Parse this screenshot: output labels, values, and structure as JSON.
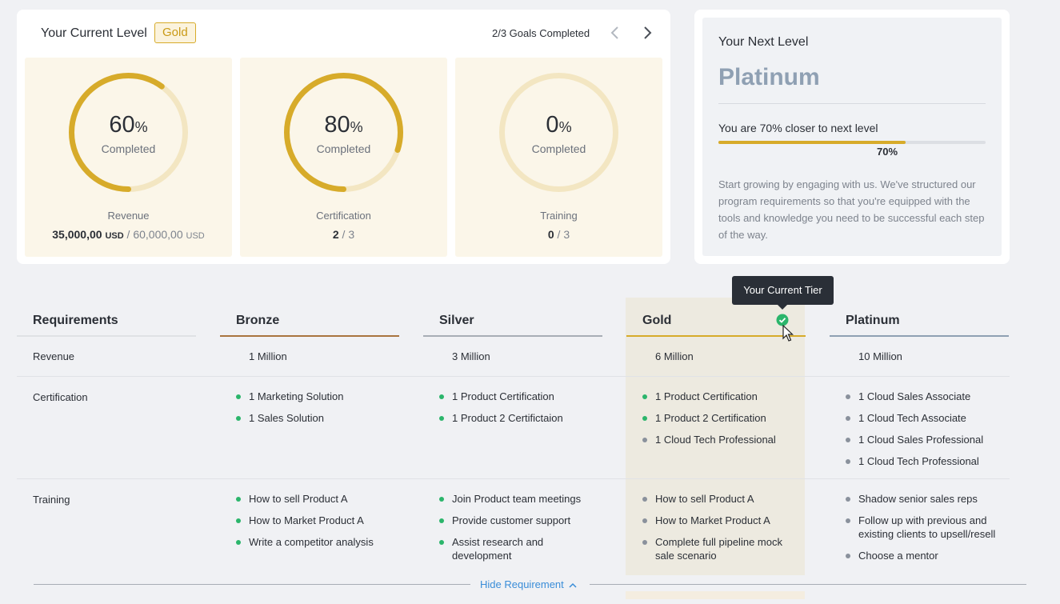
{
  "current_level": {
    "title": "Your Current Level",
    "badge": "Gold",
    "goals": "2/3 Goals Completed",
    "tiles": [
      {
        "percent": "60",
        "percent_value": 60,
        "percent_sign": "%",
        "completed_label": "Completed",
        "name": "Revenue",
        "value_bold": "35,000,00",
        "value_unit": "USD",
        "value_rest": " / 60,000,00 ",
        "value_rest_unit": "USD"
      },
      {
        "percent": "80",
        "percent_value": 80,
        "percent_sign": "%",
        "completed_label": "Completed",
        "name": "Certification",
        "value_bold": "2",
        "value_rest": " / 3"
      },
      {
        "percent": "0",
        "percent_value": 0,
        "percent_sign": "%",
        "completed_label": "Completed",
        "name": "Training",
        "value_bold": "0",
        "value_rest": " / 3"
      }
    ]
  },
  "next_level": {
    "label": "Your Next Level",
    "name": "Platinum",
    "closer_text": "You are 70% closer to next level",
    "progress": 70,
    "progress_label": "70%",
    "description": "Start growing by engaging with us. We've structured our program requirements so that you're equipped with the tools and knowledge you need to be successful each step of the way."
  },
  "tooltip": "Your Current Tier",
  "table": {
    "headers": [
      "Requirements",
      "Bronze",
      "Silver",
      "Gold",
      "Platinum"
    ],
    "rows": {
      "revenue": {
        "label": "Revenue",
        "values": [
          "1 Million",
          "3 Million",
          "6 Million",
          "10 Million"
        ]
      },
      "certification": {
        "label": "Certification",
        "bronze": [
          "1 Marketing Solution",
          "1 Sales Solution"
        ],
        "silver": [
          "1 Product Certification",
          "1 Product 2 Certifictaion"
        ],
        "gold": [
          "1 Product Certification",
          "1 Product 2 Certification",
          "1 Cloud Tech Professional"
        ],
        "platinum": [
          "1 Cloud Sales Associate",
          "1 Cloud Tech Associate",
          "1 Cloud Sales Professional",
          "1 Cloud Tech Professional"
        ]
      },
      "training": {
        "label": "Training",
        "bronze": [
          "How to sell Product A",
          "How to Market Product A",
          "Write a competitor analysis"
        ],
        "silver": [
          "Join Product team meetings",
          "Provide customer support",
          "Assist research and development"
        ],
        "gold": [
          "How to sell Product A",
          "How to Market Product A",
          "Complete full pipeline mock sale scenario"
        ],
        "platinum": [
          "Shadow senior sales reps",
          "Follow up with previous and existing clients to upsell/resell",
          "Choose a mentor"
        ]
      }
    }
  },
  "hide_requirement": "Hide Requirement",
  "colors": {
    "gold": "#d7ab2a",
    "bronze": "#a9743e",
    "silver": "#a8adb5",
    "platinum": "#8fa0b3",
    "done": "#2bb56b",
    "pending": "#8a919c"
  }
}
